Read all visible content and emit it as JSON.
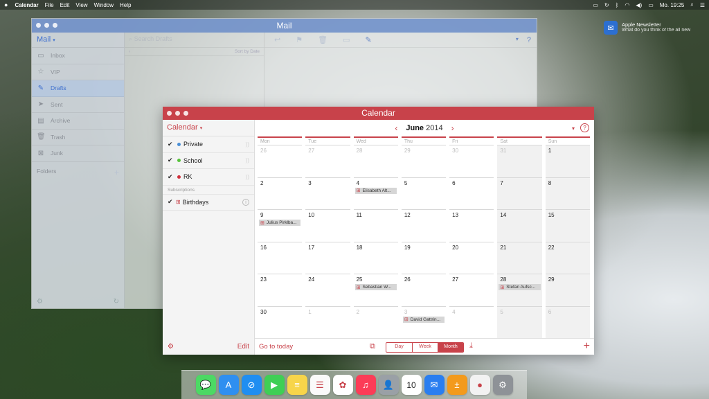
{
  "menubar": {
    "apple": "",
    "app": "Calendar",
    "items": [
      "File",
      "Edit",
      "View",
      "Window",
      "Help"
    ],
    "clock": "Mo. 19:25"
  },
  "notification": {
    "title": "Apple Newsletter",
    "body": "What do you think of the all new"
  },
  "mail": {
    "title": "Mail",
    "header": "Mail",
    "mailboxes": [
      {
        "label": "Inbox",
        "icon": "inbox-icon"
      },
      {
        "label": "VIP",
        "icon": "star-icon"
      },
      {
        "label": "Drafts",
        "icon": "pencil-icon"
      },
      {
        "label": "Sent",
        "icon": "paper-plane-icon"
      },
      {
        "label": "Archive",
        "icon": "archive-icon"
      },
      {
        "label": "Trash",
        "icon": "trash-icon"
      },
      {
        "label": "Junk",
        "icon": "junk-icon"
      }
    ],
    "folders_label": "Folders",
    "search_placeholder": "Search Drafts",
    "sort_label": "Sort by Date"
  },
  "calendar": {
    "title": "Calendar",
    "header": "Calendar",
    "calendars": [
      {
        "label": "Private",
        "color": "#4a8fd6"
      },
      {
        "label": "School",
        "color": "#56c23a"
      },
      {
        "label": "RK",
        "color": "#d0303c"
      }
    ],
    "subscriptions_label": "Subscriptions",
    "subscriptions": [
      {
        "label": "Birthdays"
      }
    ],
    "edit_label": "Edit",
    "month_name": "June",
    "year": "2014",
    "weekdays": [
      "Mon",
      "Tue",
      "Wed",
      "Thu",
      "Fri",
      "Sat",
      "Sun"
    ],
    "days": [
      {
        "n": "26",
        "other": true
      },
      {
        "n": "27",
        "other": true
      },
      {
        "n": "28",
        "other": true
      },
      {
        "n": "29",
        "other": true
      },
      {
        "n": "30",
        "other": true
      },
      {
        "n": "31",
        "other": true
      },
      {
        "n": "1",
        "other": false
      },
      {
        "n": "2"
      },
      {
        "n": "3"
      },
      {
        "n": "4",
        "event": "Elisabeth Alt..."
      },
      {
        "n": "5"
      },
      {
        "n": "6"
      },
      {
        "n": "7"
      },
      {
        "n": "8"
      },
      {
        "n": "9",
        "event": "Julius Pirklba..."
      },
      {
        "n": "10"
      },
      {
        "n": "11"
      },
      {
        "n": "12"
      },
      {
        "n": "13"
      },
      {
        "n": "14"
      },
      {
        "n": "15"
      },
      {
        "n": "16"
      },
      {
        "n": "17"
      },
      {
        "n": "18"
      },
      {
        "n": "19"
      },
      {
        "n": "20"
      },
      {
        "n": "21"
      },
      {
        "n": "22"
      },
      {
        "n": "23"
      },
      {
        "n": "24"
      },
      {
        "n": "25",
        "event": "Sebastian W..."
      },
      {
        "n": "26"
      },
      {
        "n": "27"
      },
      {
        "n": "28",
        "event": "Stefan Aufsc..."
      },
      {
        "n": "29"
      },
      {
        "n": "30"
      },
      {
        "n": "1",
        "other": true
      },
      {
        "n": "2",
        "other": true
      },
      {
        "n": "3",
        "other": true,
        "event": "David Gattrin..."
      },
      {
        "n": "4",
        "other": true
      },
      {
        "n": "5",
        "other": true
      },
      {
        "n": "6",
        "other": true
      }
    ],
    "go_to_today": "Go to today",
    "views": [
      "Day",
      "Week",
      "Month"
    ],
    "selected_view": "Month",
    "accent": "#c8424a"
  },
  "dock": [
    {
      "name": "messages-icon",
      "color": "#4cd964",
      "glyph": "💬"
    },
    {
      "name": "app-store-icon",
      "color": "#2f8ff0",
      "glyph": "A"
    },
    {
      "name": "safari-icon",
      "color": "#1f8ef1",
      "glyph": "⊘"
    },
    {
      "name": "facetime-icon",
      "color": "#3fcf55",
      "glyph": "▶"
    },
    {
      "name": "notes-icon",
      "color": "#f7d54a",
      "glyph": "≡"
    },
    {
      "name": "reminders-icon",
      "color": "#fafafa",
      "glyph": "☰"
    },
    {
      "name": "photos-icon",
      "color": "#ffffff",
      "glyph": "✿"
    },
    {
      "name": "itunes-icon",
      "color": "#fc3c57",
      "glyph": "♫"
    },
    {
      "name": "contacts-icon",
      "color": "#9aa0a6",
      "glyph": "👤"
    },
    {
      "name": "calendar-icon",
      "color": "#ffffff",
      "glyph": "10"
    },
    {
      "name": "mail-icon",
      "color": "#2a7ef0",
      "glyph": "✉"
    },
    {
      "name": "calculator-icon",
      "color": "#f39a1c",
      "glyph": "±"
    },
    {
      "name": "game-center-icon",
      "color": "#f2f2f2",
      "glyph": "●"
    },
    {
      "name": "system-preferences-icon",
      "color": "#8e9297",
      "glyph": "⚙"
    }
  ]
}
